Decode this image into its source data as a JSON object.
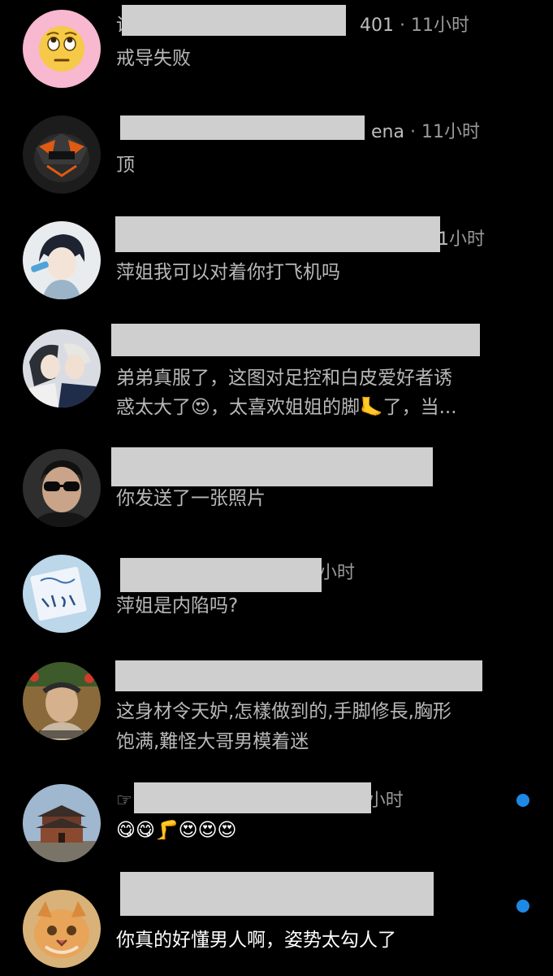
{
  "threads": [
    {
      "name_fragment": "讨",
      "name_tail": "401",
      "time": "11小时",
      "message": "戒导失败",
      "unread": false
    },
    {
      "name_fragment": "",
      "name_tail": "ena",
      "time": "11小时",
      "message": "顶",
      "unread": false
    },
    {
      "name_fragment": "",
      "name_tail": "1",
      "time": "小时",
      "message": "萍姐我可以对着你打飞机吗",
      "unread": false
    },
    {
      "name_fragment": "",
      "name_tail": "",
      "time": "",
      "message_line1": "弟弟真服了，这图对足控和白皮爱好者诱",
      "message_line2": "惑太大了😍，太喜欢姐姐的脚🦶了，当...",
      "unread": false
    },
    {
      "name_fragment": "",
      "name_tail": "",
      "time": "",
      "message": "你发送了一张照片",
      "unread": false
    },
    {
      "name_fragment": "",
      "name_tail": "",
      "time": "小时",
      "message": "萍姐是内陷吗?",
      "unread": false
    },
    {
      "name_fragment": "",
      "name_tail": "",
      "time": "",
      "message_line1": "这身材令天妒,怎樣做到的,手脚修長,胸形",
      "message_line2": "饱满,難怪大哥男模着迷",
      "unread": false
    },
    {
      "name_fragment": "☞",
      "name_tail": "",
      "time": "小时",
      "message": "😋😋🦵😍😍😍",
      "unread": true
    },
    {
      "name_fragment": "",
      "name_tail": "",
      "time": "",
      "message": "你真的好懂男人啊，姿势太勾人了",
      "unread": true
    }
  ],
  "colors": {
    "background": "#000000",
    "unread_dot": "#1e88e5",
    "redaction": "#cfcfcf"
  }
}
